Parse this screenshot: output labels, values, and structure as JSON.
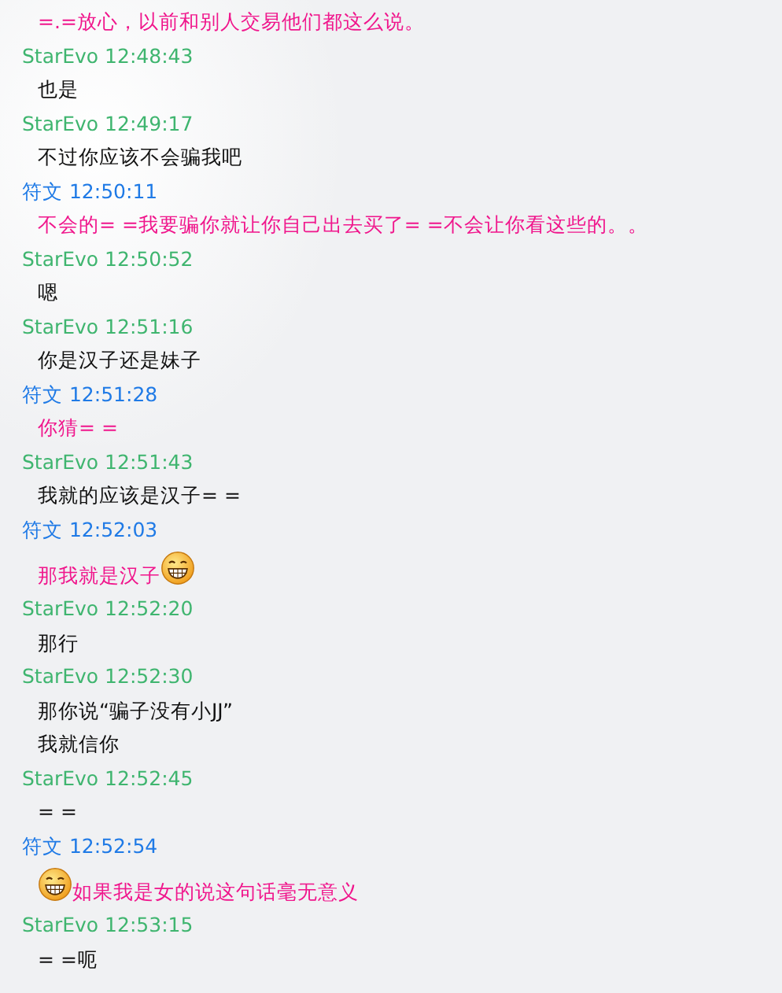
{
  "messages": [
    {
      "lines": [
        [
          {
            "kind": "text",
            "text": "=.=放心，以前和别人交易他们都这么说。"
          }
        ]
      ],
      "kind": "self"
    },
    {
      "sender": "StarEvo",
      "time": "12:48:43",
      "kind": "peer",
      "lines": [
        [
          {
            "kind": "text",
            "text": "也是"
          }
        ]
      ]
    },
    {
      "sender": "StarEvo",
      "time": "12:49:17",
      "kind": "peer",
      "lines": [
        [
          {
            "kind": "text",
            "text": "不过你应该不会骗我吧"
          }
        ]
      ]
    },
    {
      "sender": "符文",
      "time": "12:50:11",
      "kind": "self",
      "lines": [
        [
          {
            "kind": "text",
            "text": "不会的= =我要骗你就让你自己出去买了= =不会让你看这些的。。"
          }
        ]
      ]
    },
    {
      "sender": "StarEvo",
      "time": "12:50:52",
      "kind": "peer",
      "lines": [
        [
          {
            "kind": "text",
            "text": "嗯"
          }
        ]
      ]
    },
    {
      "sender": "StarEvo",
      "time": "12:51:16",
      "kind": "peer",
      "lines": [
        [
          {
            "kind": "text",
            "text": "你是汉子还是妹子"
          }
        ]
      ]
    },
    {
      "sender": "符文",
      "time": "12:51:28",
      "kind": "self",
      "lines": [
        [
          {
            "kind": "text",
            "text": "你猜= ="
          }
        ]
      ]
    },
    {
      "sender": "StarEvo",
      "time": "12:51:43",
      "kind": "peer",
      "lines": [
        [
          {
            "kind": "text",
            "text": "我就的应该是汉子= ="
          }
        ]
      ]
    },
    {
      "sender": "符文",
      "time": "12:52:03",
      "kind": "self",
      "lines": [
        [
          {
            "kind": "text",
            "text": "那我就是汉子"
          },
          {
            "kind": "emoji"
          }
        ]
      ]
    },
    {
      "sender": "StarEvo",
      "time": "12:52:20",
      "kind": "peer",
      "lines": [
        [
          {
            "kind": "text",
            "text": "那行"
          }
        ]
      ]
    },
    {
      "sender": "StarEvo",
      "time": "12:52:30",
      "kind": "peer",
      "lines": [
        [
          {
            "kind": "text",
            "text": "那你说“骗子没有小JJ”"
          }
        ],
        [
          {
            "kind": "text",
            "text": "我就信你"
          }
        ]
      ]
    },
    {
      "sender": "StarEvo",
      "time": "12:52:45",
      "kind": "peer",
      "lines": [
        [
          {
            "kind": "text",
            "text": "= ="
          }
        ]
      ]
    },
    {
      "sender": "符文",
      "time": "12:52:54",
      "kind": "self",
      "lines": [
        [
          {
            "kind": "emoji"
          },
          {
            "kind": "text",
            "text": "如果我是女的说这句话毫无意义"
          }
        ]
      ]
    },
    {
      "sender": "StarEvo",
      "time": "12:53:15",
      "kind": "peer",
      "lines": [
        [
          {
            "kind": "text",
            "text": "= =呃"
          }
        ]
      ]
    }
  ]
}
